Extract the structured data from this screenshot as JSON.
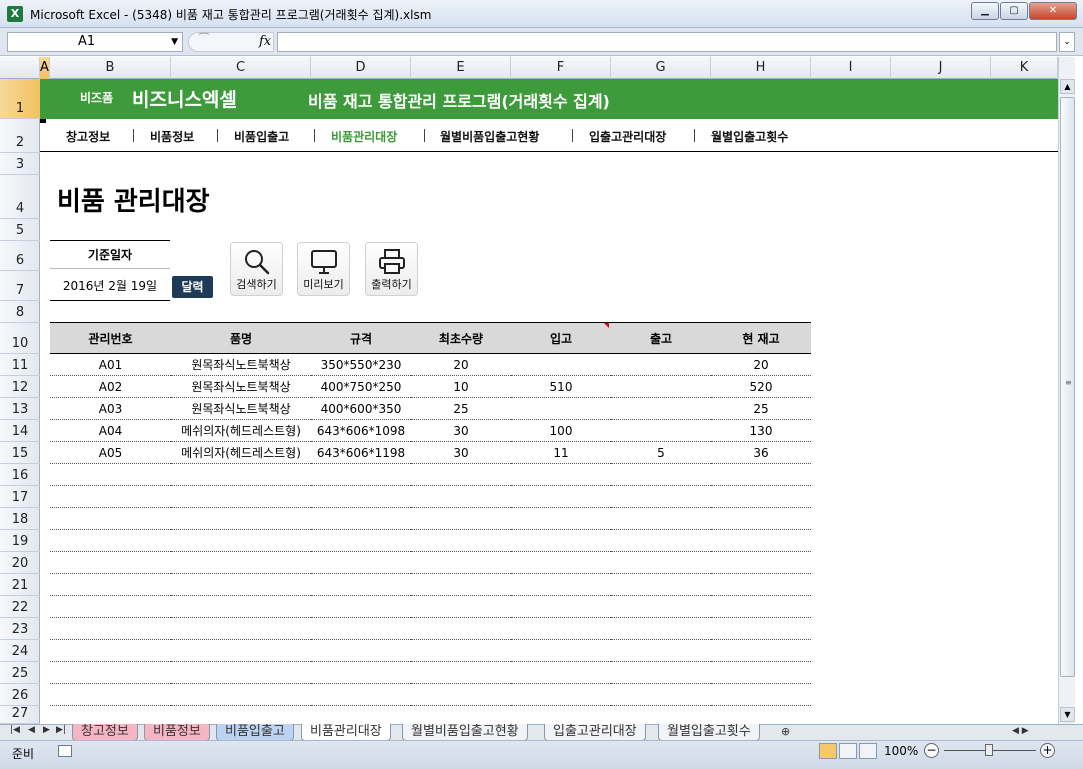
{
  "window": {
    "title": "Microsoft Excel - (5348) 비품 재고 통합관리 프로그램(거래횟수 집계).xlsm",
    "app_icon_letter": "X",
    "minimize": "▁",
    "maximize": "▢",
    "close": "✕"
  },
  "formula_bar": {
    "name_box": "A1",
    "fx_label": "fx",
    "formula": ""
  },
  "columns": [
    "A",
    "B",
    "C",
    "D",
    "E",
    "F",
    "G",
    "H",
    "I",
    "J",
    "K"
  ],
  "rows": [
    "1",
    "2",
    "3",
    "4",
    "5",
    "6",
    "7",
    "8",
    "10",
    "11",
    "12",
    "13",
    "14",
    "15",
    "16",
    "17",
    "18",
    "19",
    "20",
    "21",
    "22",
    "23",
    "24",
    "25",
    "26",
    "27"
  ],
  "banner": {
    "brand_small": "비즈폼",
    "brand": "비즈니스엑셀",
    "program_title": "비품 재고 통합관리 프로그램(거래횟수 집계)",
    "color": "#3e9b3b"
  },
  "nav": {
    "items": [
      "창고정보",
      "비품정보",
      "비품입출고",
      "비품관리대장",
      "월별비품입출고현황",
      "입출고관리대장",
      "월별입출고횟수"
    ],
    "active_index": 3,
    "active_color": "#3a9a3a"
  },
  "page_title": "비품 관리대장",
  "date_box": {
    "label": "기준일자",
    "value": "2016년 2월 19일",
    "calendar_button": "달력"
  },
  "tools": {
    "search": "검색하기",
    "preview": "미리보기",
    "print": "출력하기"
  },
  "table": {
    "headers": [
      "관리번호",
      "품명",
      "규격",
      "최초수량",
      "입고",
      "출고",
      "현 재고"
    ],
    "rows": [
      [
        "A01",
        "원목좌식노트북책상",
        "350*550*230",
        "20",
        "",
        "",
        "20"
      ],
      [
        "A02",
        "원목좌식노트북책상",
        "400*750*250",
        "10",
        "510",
        "",
        "520"
      ],
      [
        "A03",
        "원목좌식노트북책상",
        "400*600*350",
        "25",
        "",
        "",
        "25"
      ],
      [
        "A04",
        "메쉬의자(헤드레스트형)",
        "643*606*1098",
        "30",
        "100",
        "",
        "130"
      ],
      [
        "A05",
        "메쉬의자(헤드레스트형)",
        "643*606*1198",
        "30",
        "11",
        "5",
        "36"
      ]
    ],
    "empty_rows": 12
  },
  "sheet_tabs": [
    {
      "label": "창고정보",
      "style": "pink"
    },
    {
      "label": "비품정보",
      "style": "pink"
    },
    {
      "label": "비품입출고",
      "style": "blue"
    },
    {
      "label": "비품관리대장",
      "style": "active"
    },
    {
      "label": "월별비품입출고현황",
      "style": "plain"
    },
    {
      "label": "입출고관리대장",
      "style": "plain"
    },
    {
      "label": "월별입출고횟수",
      "style": "plain"
    }
  ],
  "status": {
    "ready": "준비",
    "zoom": "100%"
  }
}
